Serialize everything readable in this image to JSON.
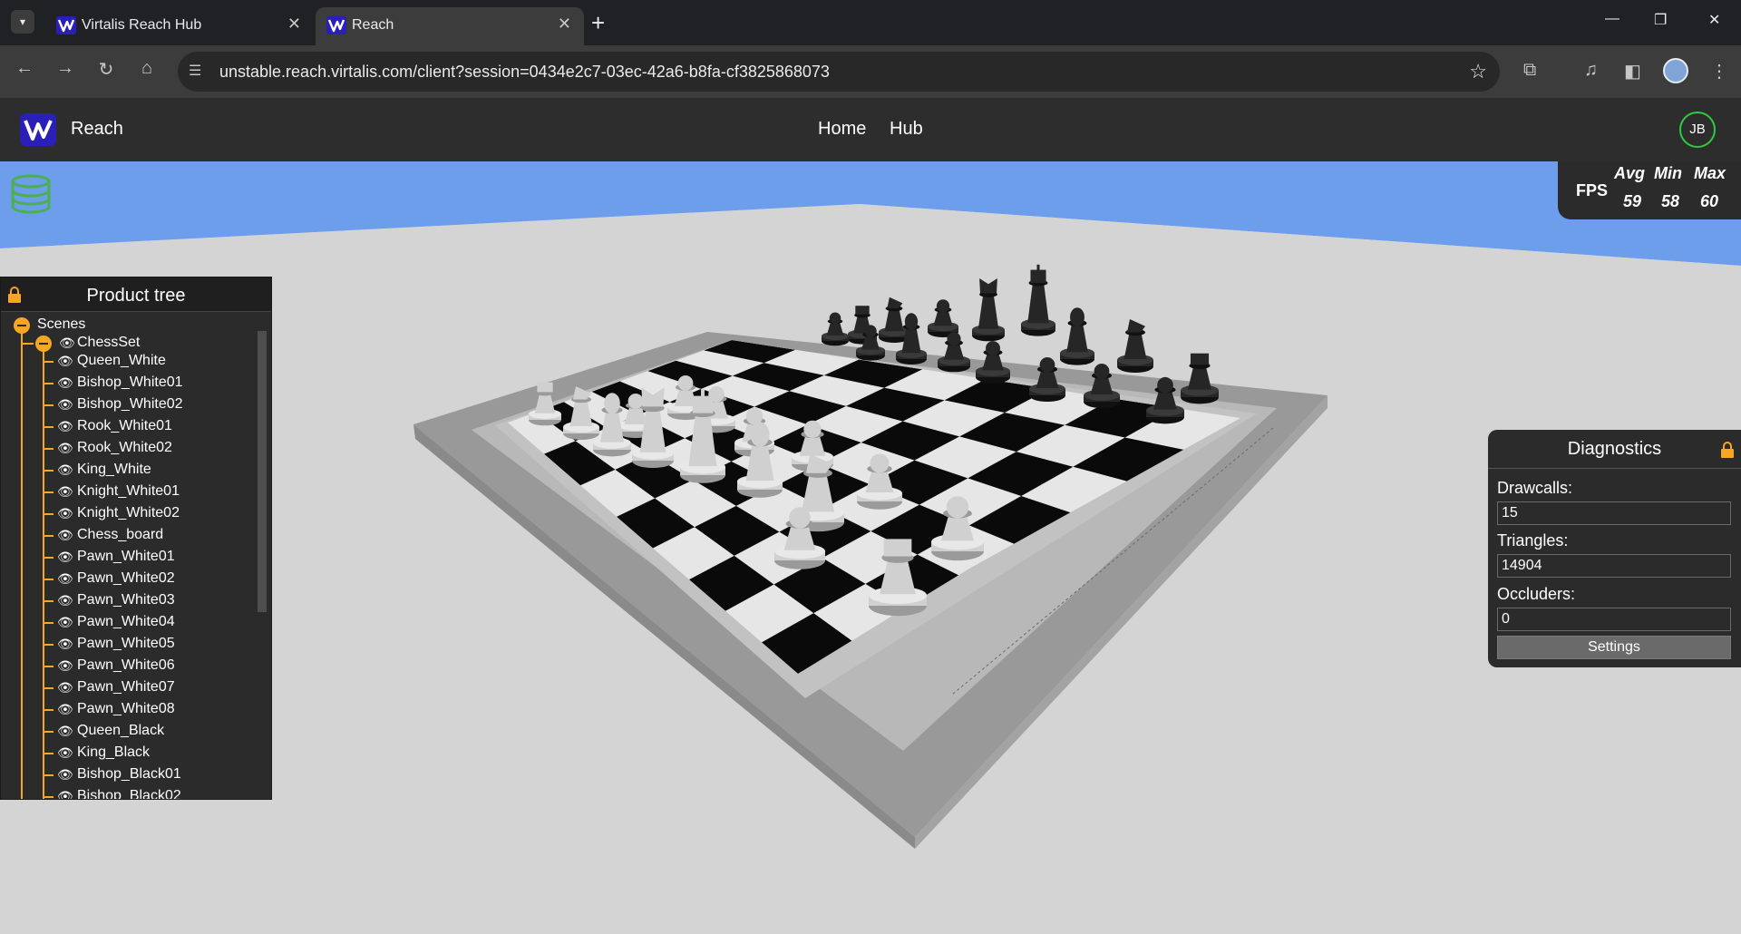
{
  "browser": {
    "tabs": [
      {
        "title": "Virtalis Reach Hub",
        "active": false
      },
      {
        "title": "Reach",
        "active": true
      }
    ],
    "url": "unstable.reach.virtalis.com/client?session=0434e2c7-03ec-42a6-b8fa-cf3825868073"
  },
  "app": {
    "name": "Reach",
    "nav": [
      "Home",
      "Hub"
    ],
    "user_initials": "JB",
    "brand_color": "#3a2fd0",
    "avatar_ring_color": "#2ecc40"
  },
  "fps": {
    "label": "FPS",
    "headers": [
      "Avg",
      "Min",
      "Max"
    ],
    "values": [
      "59",
      "58",
      "60"
    ]
  },
  "product_tree": {
    "title": "Product tree",
    "root": "Scenes",
    "group": "ChessSet",
    "items": [
      "Queen_White",
      "Bishop_White01",
      "Bishop_White02",
      "Rook_White01",
      "Rook_White02",
      "King_White",
      "Knight_White01",
      "Knight_White02",
      "Chess_board",
      "Pawn_White01",
      "Pawn_White02",
      "Pawn_White03",
      "Pawn_White04",
      "Pawn_White05",
      "Pawn_White06",
      "Pawn_White07",
      "Pawn_White08",
      "Queen_Black",
      "King_Black",
      "Bishop_Black01",
      "Bishop_Black02"
    ],
    "accent_color": "#f5a623"
  },
  "diagnostics": {
    "title": "Diagnostics",
    "fields": [
      {
        "label": "Drawcalls:",
        "value": "15"
      },
      {
        "label": "Triangles:",
        "value": "14904"
      },
      {
        "label": "Occluders:",
        "value": "0"
      }
    ],
    "settings_label": "Settings"
  },
  "scene": {
    "sky_color": "#6d9eeb",
    "floor_color": "#d4d4d4"
  }
}
